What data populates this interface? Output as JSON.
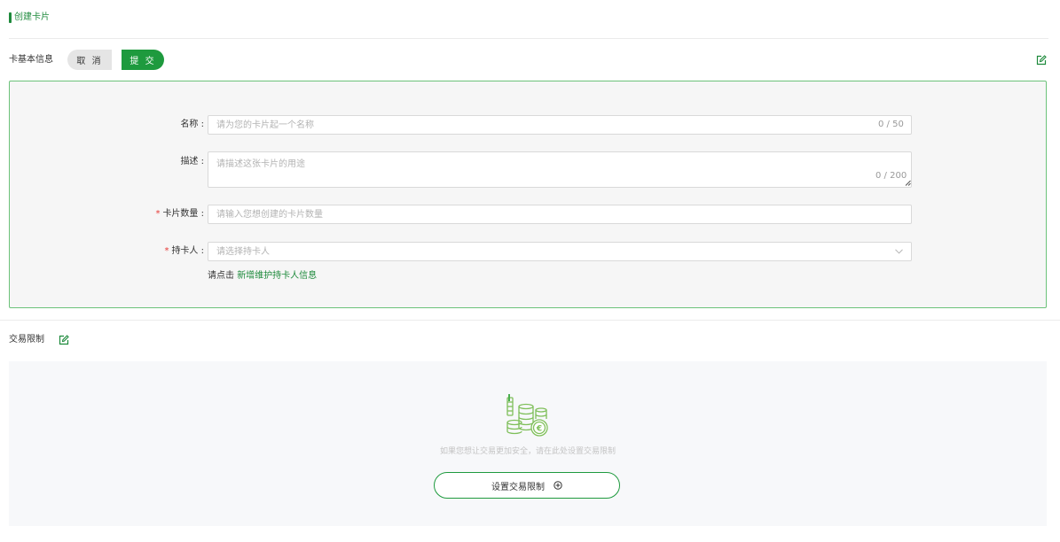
{
  "header": {
    "title": "创建卡片"
  },
  "basic_info": {
    "label": "卡基本信息",
    "cancel_label": "取 消",
    "submit_label": "提 交"
  },
  "form": {
    "name": {
      "label": "名称 :",
      "placeholder": "请为您的卡片起一个名称",
      "counter": "0 / 50"
    },
    "description": {
      "label": "描述 :",
      "placeholder": "请描述这张卡片的用途",
      "counter": "0 / 200"
    },
    "quantity": {
      "required_mark": "*",
      "label": "卡片数量 :",
      "placeholder": "请输入您想创建的卡片数量"
    },
    "holder": {
      "required_mark": "*",
      "label": "持卡人 :",
      "placeholder": "请选择持卡人"
    },
    "hint": {
      "prefix": "请点击",
      "link": "新增维护持卡人信息"
    }
  },
  "transaction_limit": {
    "label": "交易限制",
    "empty_text": "如果您想让交易更加安全，请在此处设置交易限制",
    "button_label": "设置交易限制"
  },
  "colors": {
    "accent": "#1e9a3e",
    "panel_border": "#6cc27a",
    "required": "#e53935"
  }
}
